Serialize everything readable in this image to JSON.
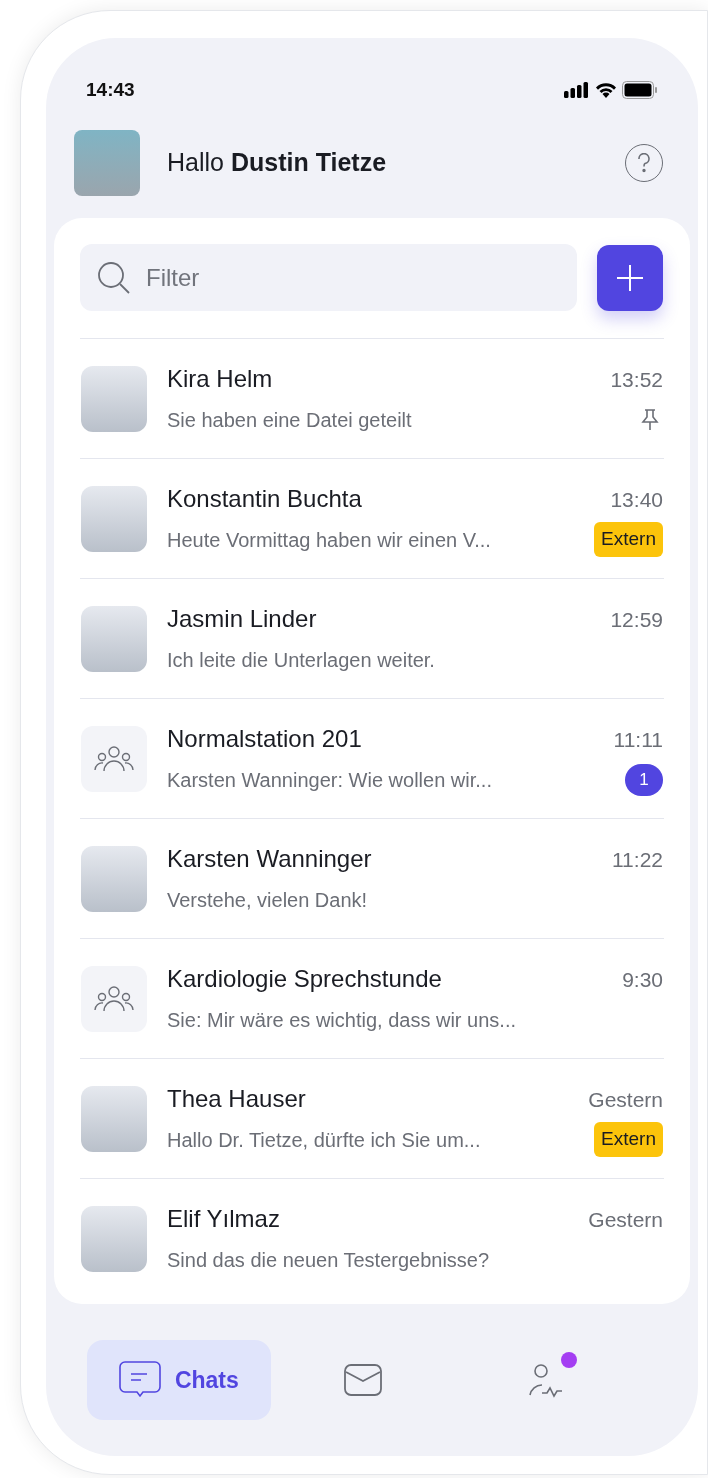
{
  "status_bar": {
    "time": "14:43"
  },
  "header": {
    "greeting": "Hallo **Dustin Tietze**"
  },
  "search": {
    "placeholder": "Filter"
  },
  "chats": [
    {
      "name": "Kira Helm",
      "preview": "Sie haben eine Datei geteilt",
      "time": "13:52",
      "kind": "photo",
      "pinned": true
    },
    {
      "name": "Konstantin Buchta",
      "preview": "Heute Vormittag haben wir einen V...",
      "time": "13:40",
      "kind": "photo",
      "pinned": false,
      "tag": "Extern"
    },
    {
      "name": "Jasmin Linder",
      "preview": "Ich leite die Unterlagen weiter.",
      "time": "12:59",
      "kind": "photo",
      "pinned": false
    },
    {
      "name": "Normalstation 201",
      "preview": "Karsten Wanninger: Wie wollen wir...",
      "time": "11:11",
      "kind": "group",
      "pinned": false,
      "unread": "1"
    },
    {
      "name": "Karsten Wanninger",
      "preview": "Verstehe, vielen Dank!",
      "time": "11:22",
      "kind": "photo",
      "pinned": false
    },
    {
      "name": "Kardiologie Sprechstunde",
      "preview": "Sie: Mir wäre es wichtig, dass wir uns...",
      "time": "9:30",
      "kind": "group",
      "pinned": false
    },
    {
      "name": "Thea Hauser",
      "preview": "Hallo Dr. Tietze, dürfte ich Sie um...",
      "time": "Gestern",
      "kind": "photo",
      "pinned": false,
      "tag": "Extern"
    },
    {
      "name": "Elif Yılmaz",
      "preview": "Sind das die neuen Testergebnisse?",
      "time": "Gestern",
      "kind": "photo",
      "pinned": false
    }
  ],
  "nav": [
    {
      "kind": "chats",
      "label": "Chats",
      "selected": true,
      "notification": false
    },
    {
      "kind": "mail",
      "selected": false,
      "notification": false
    },
    {
      "kind": "profile",
      "selected": false,
      "notification": true
    }
  ]
}
